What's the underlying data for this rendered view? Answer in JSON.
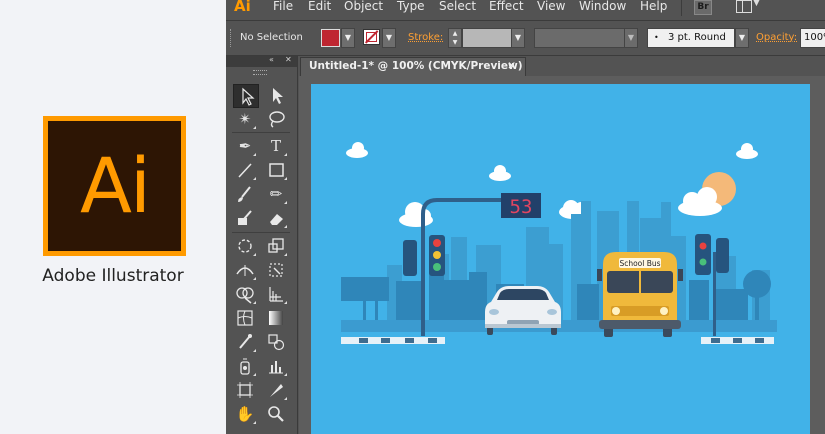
{
  "left_panel": {
    "logo_text": "Ai",
    "app_name": "Adobe Illustrator",
    "colors": {
      "logo_orange": "#ff9a00",
      "logo_dark": "#2d1504"
    }
  },
  "menubar": {
    "app_mark": "Ai",
    "items": [
      "File",
      "Edit",
      "Object",
      "Type",
      "Select",
      "Effect",
      "View",
      "Window",
      "Help"
    ],
    "bridge_label": "Br"
  },
  "control_bar": {
    "selection_status": "No Selection",
    "stroke_label": "Stroke:",
    "brush_value": "3 pt. Round",
    "brush_bullet": "•",
    "opacity_label": "Opacity:",
    "opacity_value": "100%",
    "fill_color": "#bf2631"
  },
  "tool_panel": {
    "collapse_glyph": "«",
    "close_glyph": "✕",
    "tools": [
      [
        "selection-tool",
        "direct-selection-tool"
      ],
      [
        "magic-wand-tool",
        "lasso-tool"
      ],
      [
        "pen-tool",
        "type-tool"
      ],
      [
        "line-segment-tool",
        "rectangle-tool"
      ],
      [
        "paintbrush-tool",
        "pencil-tool"
      ],
      [
        "blob-brush-tool",
        "eraser-tool"
      ],
      [
        "rotate-tool",
        "scale-tool"
      ],
      [
        "width-tool",
        "free-transform-tool"
      ],
      [
        "shape-builder-tool",
        "perspective-grid-tool"
      ],
      [
        "mesh-tool",
        "gradient-tool"
      ],
      [
        "eyedropper-tool",
        "blend-tool"
      ],
      [
        "symbol-sprayer-tool",
        "column-graph-tool"
      ],
      [
        "artboard-tool",
        "slice-tool"
      ],
      [
        "hand-tool",
        "zoom-tool"
      ]
    ]
  },
  "document": {
    "tab_title": "Untitled-1* @ 100% (CMYK/Preview)",
    "close_glyph": "✕"
  },
  "artwork": {
    "signal_number": "53",
    "bus_label": "School Bus",
    "colors": {
      "sky": "#41b2e8",
      "city_light": "#3c9ed1",
      "city_dark": "#2f7fae",
      "bus": "#f0b93b",
      "sun": "#f4b979",
      "car": "#eef1f4"
    }
  }
}
